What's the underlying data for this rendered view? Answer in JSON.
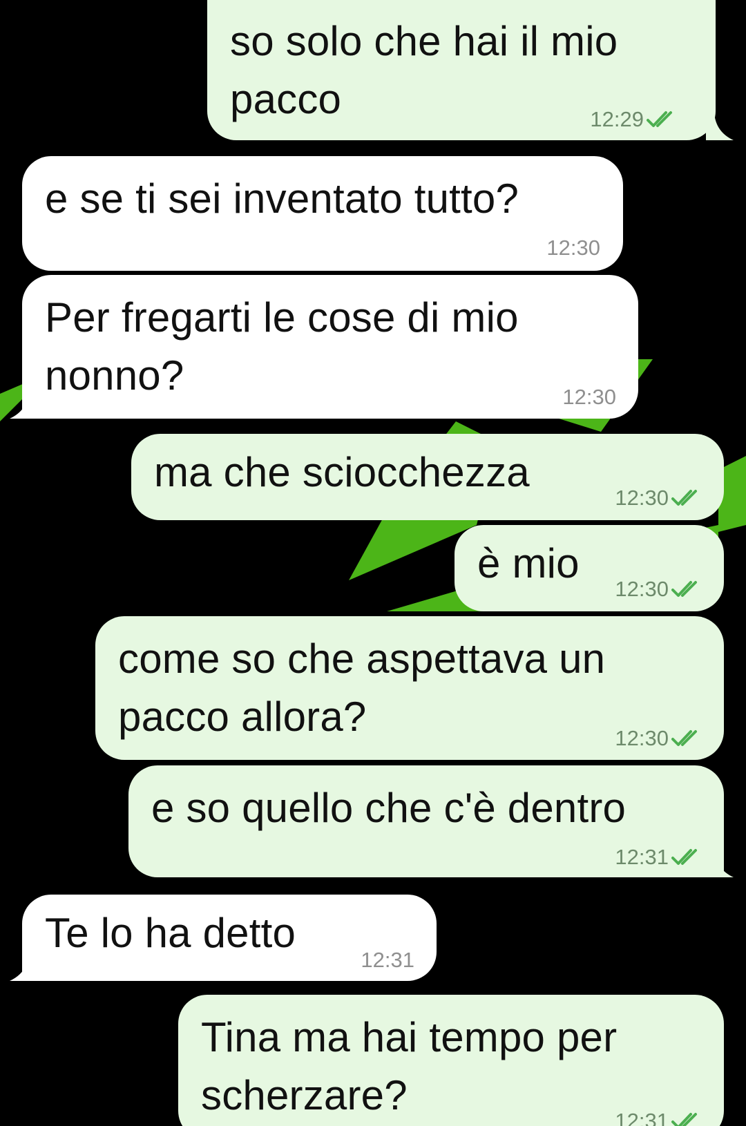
{
  "theme": {
    "background": "#000000",
    "wallpaper_green": "#4cb518",
    "outgoing_bubble": "#e6f8e1",
    "incoming_bubble": "#ffffff",
    "tick_color": "#4caf50"
  },
  "messages": [
    {
      "direction": "out",
      "text": "so solo che hai il mio\npacco",
      "time": "12:29",
      "status": "read",
      "status_icon": "double-check-icon"
    },
    {
      "direction": "in",
      "text": "e se ti sei inventato tutto?",
      "time": "12:30"
    },
    {
      "direction": "in",
      "text": "Per fregarti le cose di mio\nnonno?",
      "time": "12:30"
    },
    {
      "direction": "out",
      "text": "ma che sciocchezza",
      "time": "12:30",
      "status": "read",
      "status_icon": "double-check-icon"
    },
    {
      "direction": "out",
      "text": "è mio",
      "time": "12:30",
      "status": "read",
      "status_icon": "double-check-icon"
    },
    {
      "direction": "out",
      "text": "come so che aspettava un\npacco allora?",
      "time": "12:30",
      "status": "read",
      "status_icon": "double-check-icon"
    },
    {
      "direction": "out",
      "text": "e so quello che c'è dentro",
      "time": "12:31",
      "status": "read",
      "status_icon": "double-check-icon"
    },
    {
      "direction": "in",
      "text": "Te lo ha detto",
      "time": "12:31"
    },
    {
      "direction": "out",
      "text": "Tina ma hai tempo per\nscherzare?",
      "time": "12:31",
      "status": "read",
      "status_icon": "double-check-icon"
    }
  ]
}
